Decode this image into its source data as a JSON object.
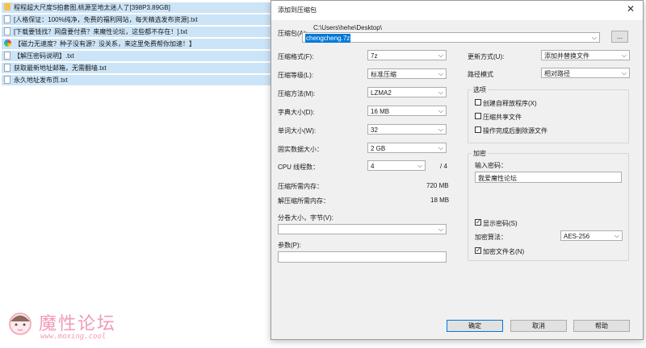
{
  "files": [
    {
      "icon": "folder",
      "name": "程程超大尺度S拍套图,桃源至地太迷人了[398P3.89GB]"
    },
    {
      "icon": "txt",
      "name": "[人格保证：100%纯净，免费的福利网站，每天精选发布资源].txt"
    },
    {
      "icon": "txt",
      "name": "[下载要钱找？网盘要付费？来魔性论坛，这些都不存在！].txt"
    },
    {
      "icon": "web",
      "name": "【磁力无速度？种子没有源？没关系，来这里免费帮你加速！】"
    },
    {
      "icon": "txt",
      "name": "【解压密码说明】.txt"
    },
    {
      "icon": "txt",
      "name": "获取最新地址邮箱，无需翻墙.txt"
    },
    {
      "icon": "txt",
      "name": "永久地址发布页.txt"
    }
  ],
  "dialog": {
    "title": "添加到压缩包",
    "close": "✕",
    "archive_label": "压缩包(A):",
    "archive_dir": "C:\\Users\\hehe\\Desktop\\",
    "archive_name": "chengcheng.7z",
    "browse": "...",
    "format_label": "压缩格式(F):",
    "format_value": "7z",
    "level_label": "压缩等级(L):",
    "level_value": "标准压缩",
    "method_label": "压缩方法(M):",
    "method_value": "LZMA2",
    "dict_label": "字典大小(D):",
    "dict_value": "16 MB",
    "word_label": "单词大小(W):",
    "word_value": "32",
    "solid_label": "固实数据大小：",
    "solid_value": "2 GB",
    "cpu_label": "CPU 线程数：",
    "cpu_value": "4",
    "cpu_total": "/ 4",
    "mem_compress_label": "压缩所需内存：",
    "mem_compress_value": "720 MB",
    "mem_decompress_label": "解压缩所需内存：",
    "mem_decompress_value": "18 MB",
    "split_label": "分卷大小，字节(V):",
    "params_label": "参数(P):",
    "update_label": "更新方式(U):",
    "update_value": "添加并替换文件",
    "path_label": "路径模式",
    "path_value": "相对路径",
    "options_title": "选项",
    "opt_sfx": "创建自释放程序(X)",
    "opt_shared": "压缩共享文件",
    "opt_delete": "操作完成后删除源文件",
    "encrypt_title": "加密",
    "password_label": "输入密码：",
    "password_value": "我爱魔性论坛",
    "show_password": "显示密码(S)",
    "enc_method_label": "加密算法：",
    "enc_method_value": "AES-256",
    "enc_names": "加密文件名(N)",
    "ok": "确定",
    "cancel": "取消",
    "help": "帮助"
  },
  "watermark": {
    "brand": "魔性论坛",
    "url": "www.moxing.cool"
  }
}
